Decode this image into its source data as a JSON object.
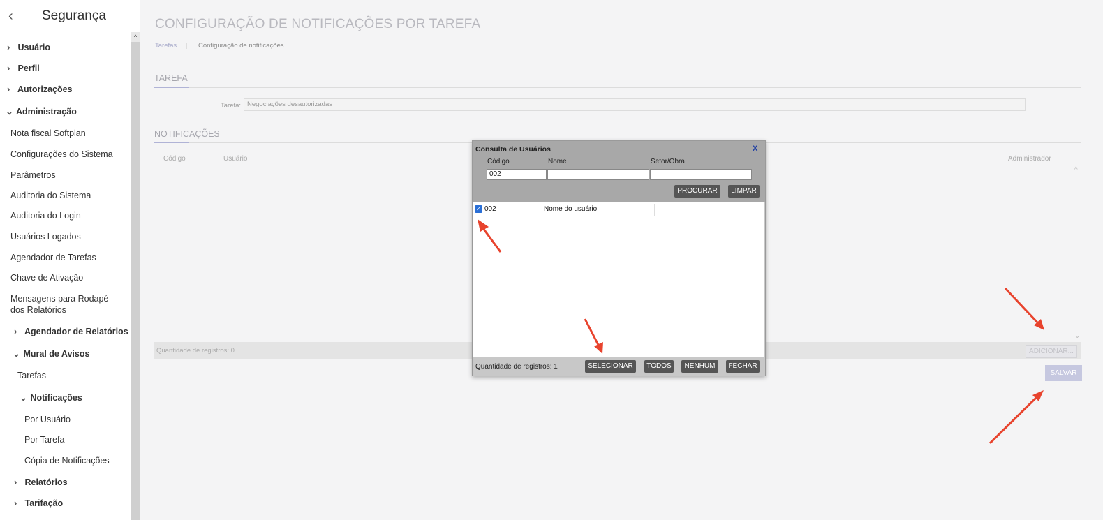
{
  "sidebar": {
    "title": "Segurança",
    "items": [
      {
        "label": "Usuário",
        "chevron": "›"
      },
      {
        "label": "Perfil",
        "chevron": "›"
      },
      {
        "label": "Autorizações",
        "chevron": "›"
      },
      {
        "label": "Administração",
        "chevron": "⌄"
      },
      {
        "label": "Nota fiscal Softplan"
      },
      {
        "label": "Configurações do Sistema"
      },
      {
        "label": "Parâmetros"
      },
      {
        "label": "Auditoria do Sistema"
      },
      {
        "label": "Auditoria do Login"
      },
      {
        "label": "Usuários Logados"
      },
      {
        "label": "Agendador de Tarefas"
      },
      {
        "label": "Chave de Ativação"
      },
      {
        "label": "Mensagens para Rodapé"
      },
      {
        "label": "dos Relatórios"
      },
      {
        "label": "Agendador de Relatórios",
        "chevron": "›"
      },
      {
        "label": "Mural de Avisos",
        "chevron": "⌄"
      },
      {
        "label": "Tarefas"
      },
      {
        "label": "Notificações",
        "chevron": "⌄"
      },
      {
        "label": "Por Usuário"
      },
      {
        "label": "Por Tarefa"
      },
      {
        "label": "Cópia de Notificações"
      },
      {
        "label": "Relatórios",
        "chevron": "›"
      },
      {
        "label": "Tarifação",
        "chevron": "›"
      }
    ]
  },
  "page": {
    "title": "CONFIGURAÇÃO DE NOTIFICAÇÕES POR TAREFA",
    "breadcrumb": {
      "link": "Tarefas",
      "separator": "|",
      "current": "Configuração de notificações"
    },
    "section_tarefa": "TAREFA",
    "tarefa_label": "Tarefa:",
    "tarefa_value": "Negociações desautorizadas",
    "section_notificacoes": "NOTIFICAÇÕES",
    "grid": {
      "col_codigo": "Código",
      "col_usuario": "Usuário",
      "col_administrador": "Administrador",
      "count": "Quantidade de registros: 0"
    },
    "btn_adicionar": "ADICIONAR...",
    "btn_salvar": "SALVAR"
  },
  "modal": {
    "title": "Consulta de Usuários",
    "close": "X",
    "label_codigo": "Código",
    "label_nome": "Nome",
    "label_setor": "Setor/Obra",
    "value_codigo": "002",
    "value_nome": "",
    "value_setor": "",
    "btn_procurar": "PROCURAR",
    "btn_limpar": "LIMPAR",
    "result": {
      "codigo": "002",
      "nome": "Nome do usuário",
      "check": "✓"
    },
    "count": "Quantidade de registros: 1",
    "btn_selecionar": "SELECIONAR",
    "btn_todos": "TODOS",
    "btn_nenhum": "NENHUM",
    "btn_fechar": "FECHAR"
  },
  "icons": {
    "back": "‹",
    "scroll_up": "^",
    "scroll_down": "⌄"
  },
  "colors": {
    "accent": "#b0b3d6",
    "arrow": "#e8432d",
    "checkbox": "#2a6fd6"
  }
}
